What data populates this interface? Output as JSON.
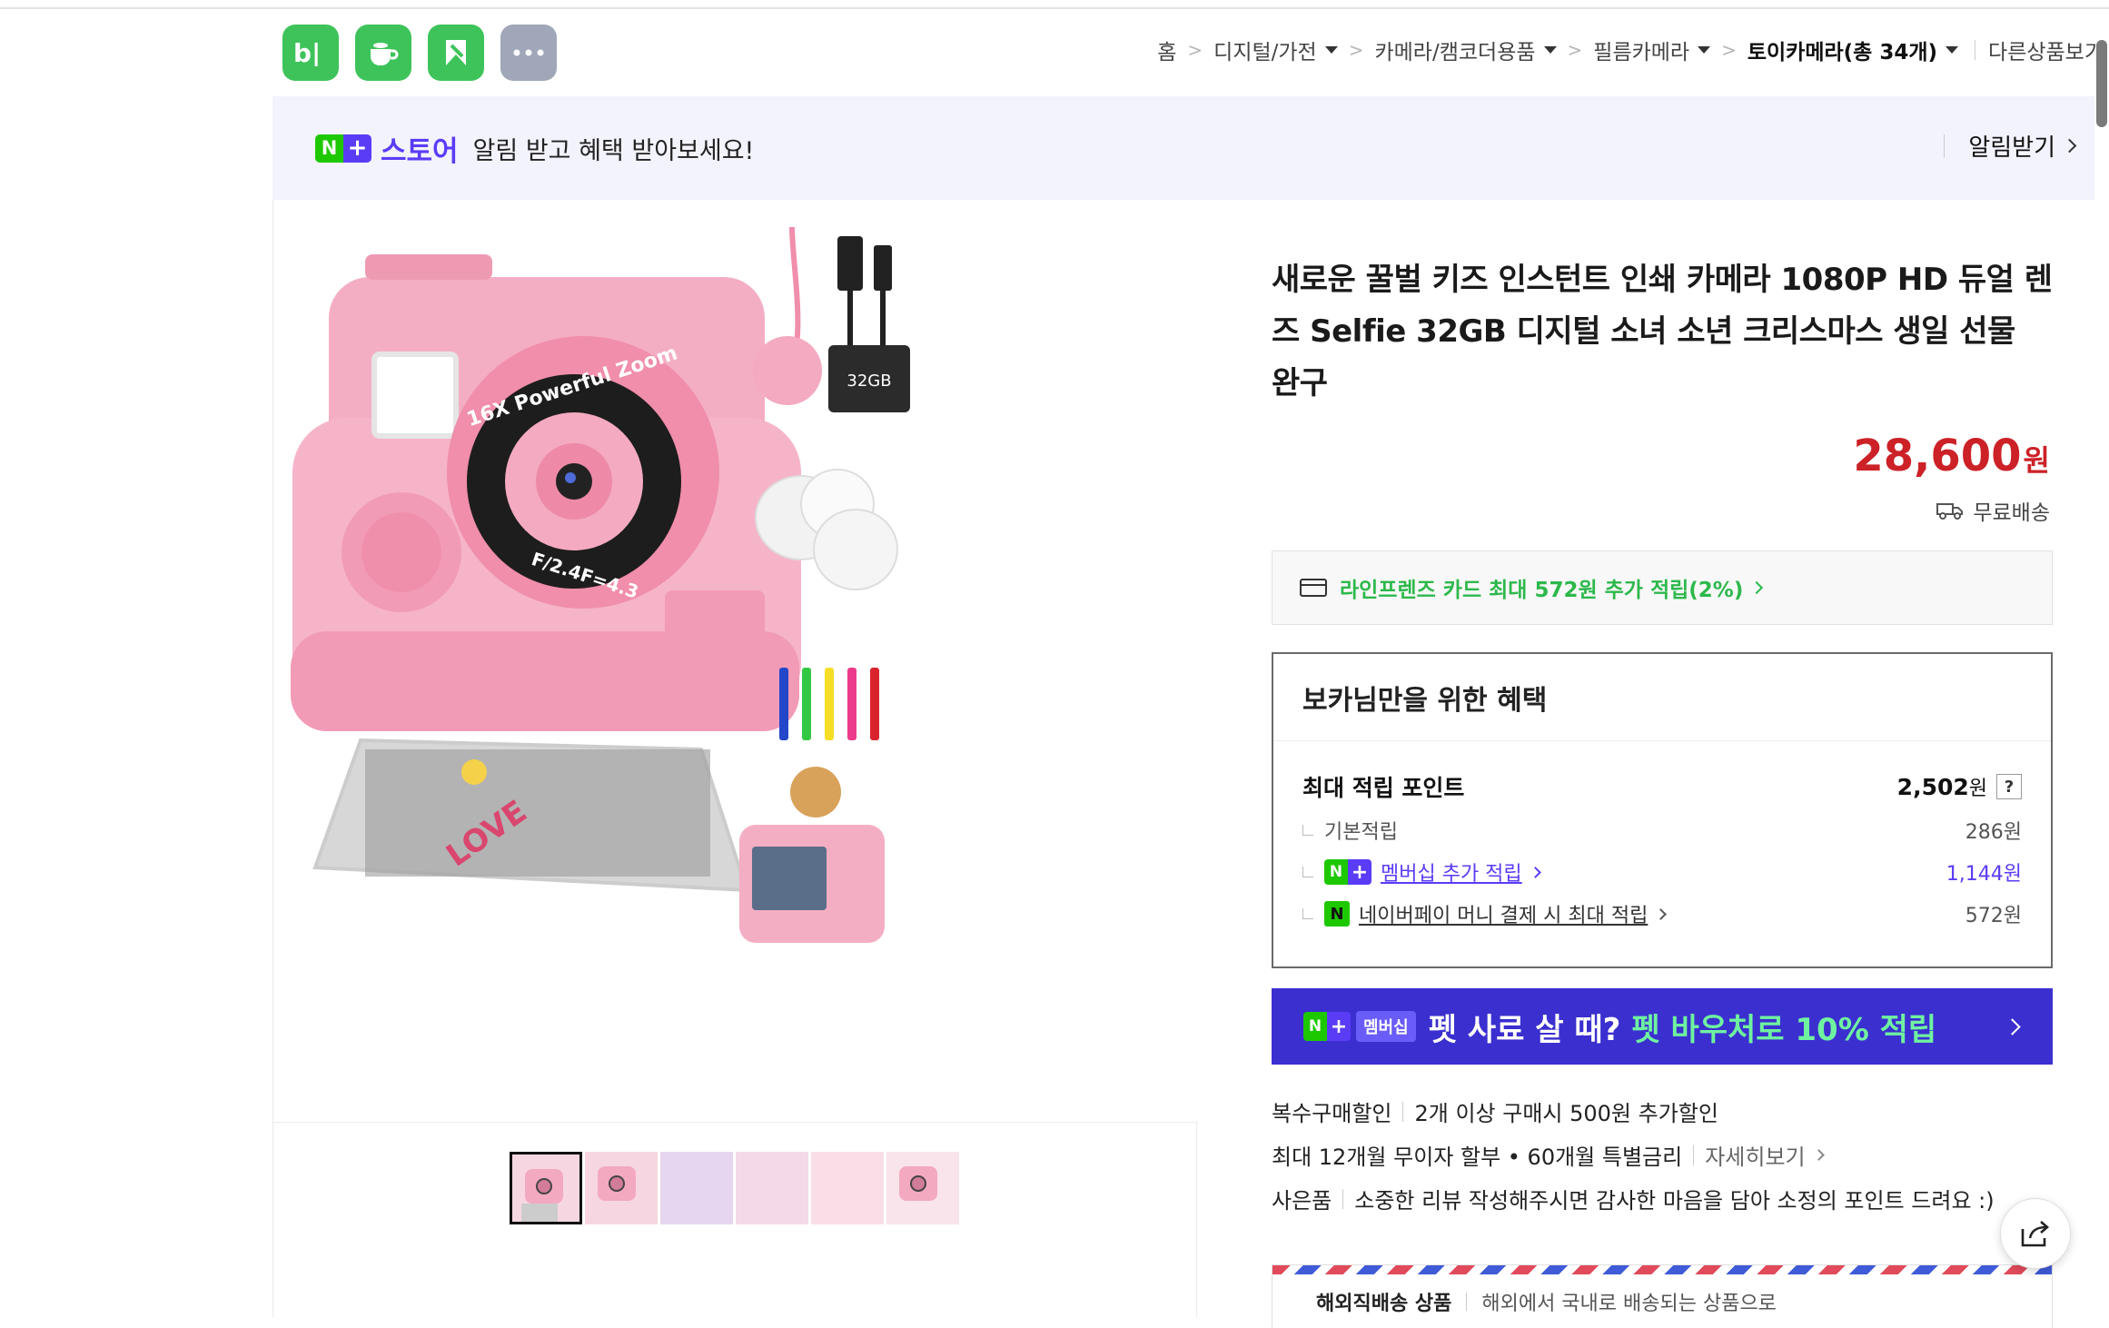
{
  "apps": [
    {
      "name": "blog",
      "glyph": "b|",
      "color": "#3ec35a"
    },
    {
      "name": "cafe",
      "glyph": "cup",
      "color": "#3ec35a"
    },
    {
      "name": "bookmark",
      "glyph": "flag",
      "color": "#3ec35a"
    },
    {
      "name": "more",
      "glyph": "···",
      "color": "#9fa7b8"
    }
  ],
  "breadcrumb": {
    "home": "홈",
    "cat1": "디지털/가전",
    "cat2": "카메라/캠코더용품",
    "cat3": "필름카메라",
    "cat4": "토이카메라(총 34개)",
    "other": "다른상품보기"
  },
  "banner": {
    "badge_n": "N",
    "badge_plus": "+",
    "store": "스토어",
    "message": "알림 받고 혜택 받아보세요!",
    "action": "알림받기"
  },
  "product": {
    "title": "새로운 꿀벌 키즈 인스턴트 인쇄 카메라 1080P HD 듀얼 렌즈 Selfie 32GB 디지털 소녀 소년 크리스마스 생일 선물 완구",
    "price": "28,600",
    "price_unit": "원",
    "shipping": "무료배송"
  },
  "image_labels": {
    "zoom_ring": "16X Powerful Zoom",
    "aperture": "F/2.4F=4.3",
    "sd_card": "32GB",
    "love": "LOVE"
  },
  "thumbnails": [
    {
      "label": "thumb-1",
      "active": true
    },
    {
      "label": "thumb-2",
      "active": false
    },
    {
      "label": "thumb-3",
      "active": false
    },
    {
      "label": "thumb-4",
      "active": false
    },
    {
      "label": "thumb-5",
      "active": false
    },
    {
      "label": "thumb-6",
      "active": false
    }
  ],
  "card_promo": "라인프렌즈 카드 최대 572원 추가 적립(2%)",
  "benefit": {
    "heading": "보카님만을 위한 혜택",
    "max_points_label": "최대 적립 포인트",
    "max_points_value": "2,502",
    "unit": "원",
    "help": "?",
    "basic_label": "기본적립",
    "basic_value": "286원",
    "membership_label": "멤버십 추가 적립",
    "membership_value": "1,144원",
    "naverpay_label": "네이버페이 머니 결제 시 최대 적립",
    "naverpay_value": "572원",
    "naverpay_badge": "N"
  },
  "promo_banner": {
    "member_tag": "멤버십",
    "question": "펫 사료 살 때?",
    "highlight": "펫 바우처로 10% 적립"
  },
  "info": {
    "multi_label": "복수구매할인",
    "multi_text": "2개 이상 구매시 500원 추가할인",
    "installment_text": "최대 12개월 무이자 할부 • 60개월 특별금리",
    "installment_more": "자세히보기",
    "gift_label": "사은품",
    "gift_text": "소중한 리뷰 작성해주시면 감사한 마음을 담아 소정의 포인트 드려요 :)"
  },
  "overseas": {
    "label": "해외직배송 상품",
    "text": "해외에서 국내로 배송되는 상품으로"
  },
  "colors": {
    "price_red": "#cc2127",
    "naver_green": "#1ec800",
    "plus_purple": "#5b3cf6",
    "promo_bg": "#3b2fd0",
    "promo_highlight": "#6ff2a0"
  }
}
